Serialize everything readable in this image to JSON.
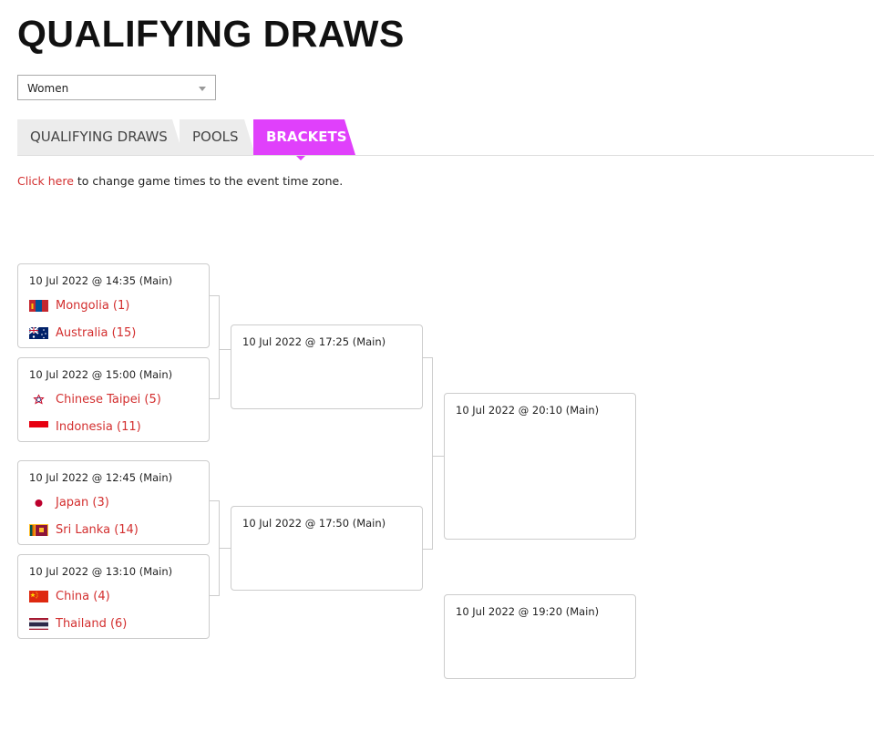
{
  "page": {
    "title": "QUALIFYING DRAWS"
  },
  "filter": {
    "selected": "Women"
  },
  "tabs": [
    {
      "label": "QUALIFYING DRAWS"
    },
    {
      "label": "POOLS"
    },
    {
      "label": "BRACKETS"
    }
  ],
  "timezone_notice": {
    "link": "Click here",
    "text": " to change game times to the event time zone."
  },
  "bracket": {
    "round1": [
      {
        "time": "10 Jul 2022 @ 14:35",
        "venue": " (Main)",
        "teams": [
          {
            "name": "Mongolia (1)",
            "flag": "mongolia-flag"
          },
          {
            "name": "Australia (15)",
            "flag": "australia-flag"
          }
        ]
      },
      {
        "time": "10 Jul 2022 @ 15:00",
        "venue": " (Main)",
        "teams": [
          {
            "name": "Chinese Taipei (5)",
            "flag": "chinese-taipei-flag"
          },
          {
            "name": "Indonesia (11)",
            "flag": "indonesia-flag"
          }
        ]
      },
      {
        "time": "10 Jul 2022 @ 12:45",
        "venue": " (Main)",
        "teams": [
          {
            "name": "Japan (3)",
            "flag": "japan-flag"
          },
          {
            "name": "Sri Lanka (14)",
            "flag": "sri-lanka-flag"
          }
        ]
      },
      {
        "time": "10 Jul 2022 @ 13:10",
        "venue": " (Main)",
        "teams": [
          {
            "name": "China (4)",
            "flag": "china-flag"
          },
          {
            "name": "Thailand (6)",
            "flag": "thailand-flag"
          }
        ]
      }
    ],
    "round2": [
      {
        "time": "10 Jul 2022 @ 17:25",
        "venue": " (Main)"
      },
      {
        "time": "10 Jul 2022 @ 17:50",
        "venue": " (Main)"
      }
    ],
    "final": {
      "time": "10 Jul 2022 @ 20:10",
      "venue": " (Main)"
    },
    "third_place": {
      "time": "10 Jul 2022 @ 19:20",
      "venue": " (Main)"
    }
  },
  "colors": {
    "accent": "#e040fb",
    "link": "#d32f2f",
    "border": "#cccccc"
  }
}
